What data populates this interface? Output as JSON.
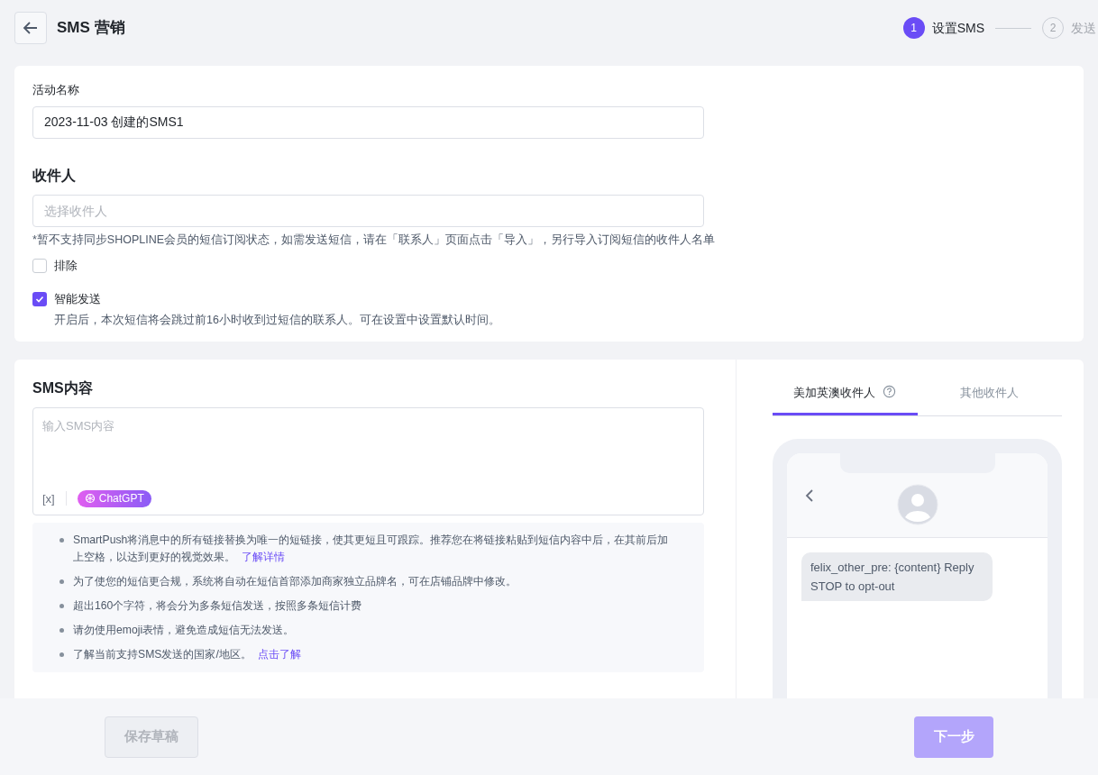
{
  "header": {
    "title": "SMS 营销",
    "steps": [
      {
        "number": "1",
        "label": "设置SMS",
        "selected": true
      },
      {
        "number": "2",
        "label": "发送",
        "selected": false
      }
    ]
  },
  "campaign": {
    "name_label": "活动名称",
    "name_value": "2023-11-03 创建的SMS1",
    "recipients_title": "收件人",
    "recipients_placeholder": "选择收件人",
    "recipients_note": "*暂不支持同步SHOPLINE会员的短信订阅状态，如需发送短信，请在「联系人」页面点击「导入」，另行导入订阅短信的收件人名单",
    "options": [
      {
        "label": "排除",
        "checked": false
      },
      {
        "label": "智能发送",
        "checked": true,
        "description": "开启后，本次短信将会跳过前16小时收到过短信的联系人。可在设置中设置默认时间。"
      }
    ]
  },
  "content": {
    "title": "SMS内容",
    "placeholder": "输入SMS内容",
    "variable_button": "[x]",
    "ai_button": "ChatGPT",
    "tips": [
      {
        "text": "SmartPush将消息中的所有链接替换为唯一的短链接，使其更短且可跟踪。推荐您在将链接粘贴到短信内容中后，在其前后加上空格，以达到更好的视觉效果。",
        "link": "了解详情"
      },
      {
        "text": "为了使您的短信更合规，系统将自动在短信首部添加商家独立品牌名，可在店铺品牌中修改。"
      },
      {
        "text": "超出160个字符，将会分为多条短信发送，按照多条短信计费"
      },
      {
        "text": "请勿使用emoji表情，避免造成短信无法发送。"
      },
      {
        "text": "了解当前支持SMS发送的国家/地区。",
        "link": "点击了解"
      }
    ]
  },
  "preview": {
    "tabs": [
      {
        "label": "美加英澳收件人",
        "selected": true,
        "help": true
      },
      {
        "label": "其他收件人",
        "selected": false,
        "help": false
      }
    ],
    "message": "felix_other_pre: {content} Reply STOP to opt-out"
  },
  "footer": {
    "buttons": [
      {
        "label": "保存草稿",
        "kind": "secondary",
        "disabled": true
      },
      {
        "label": "下一步",
        "kind": "primary",
        "disabled": true
      }
    ]
  }
}
